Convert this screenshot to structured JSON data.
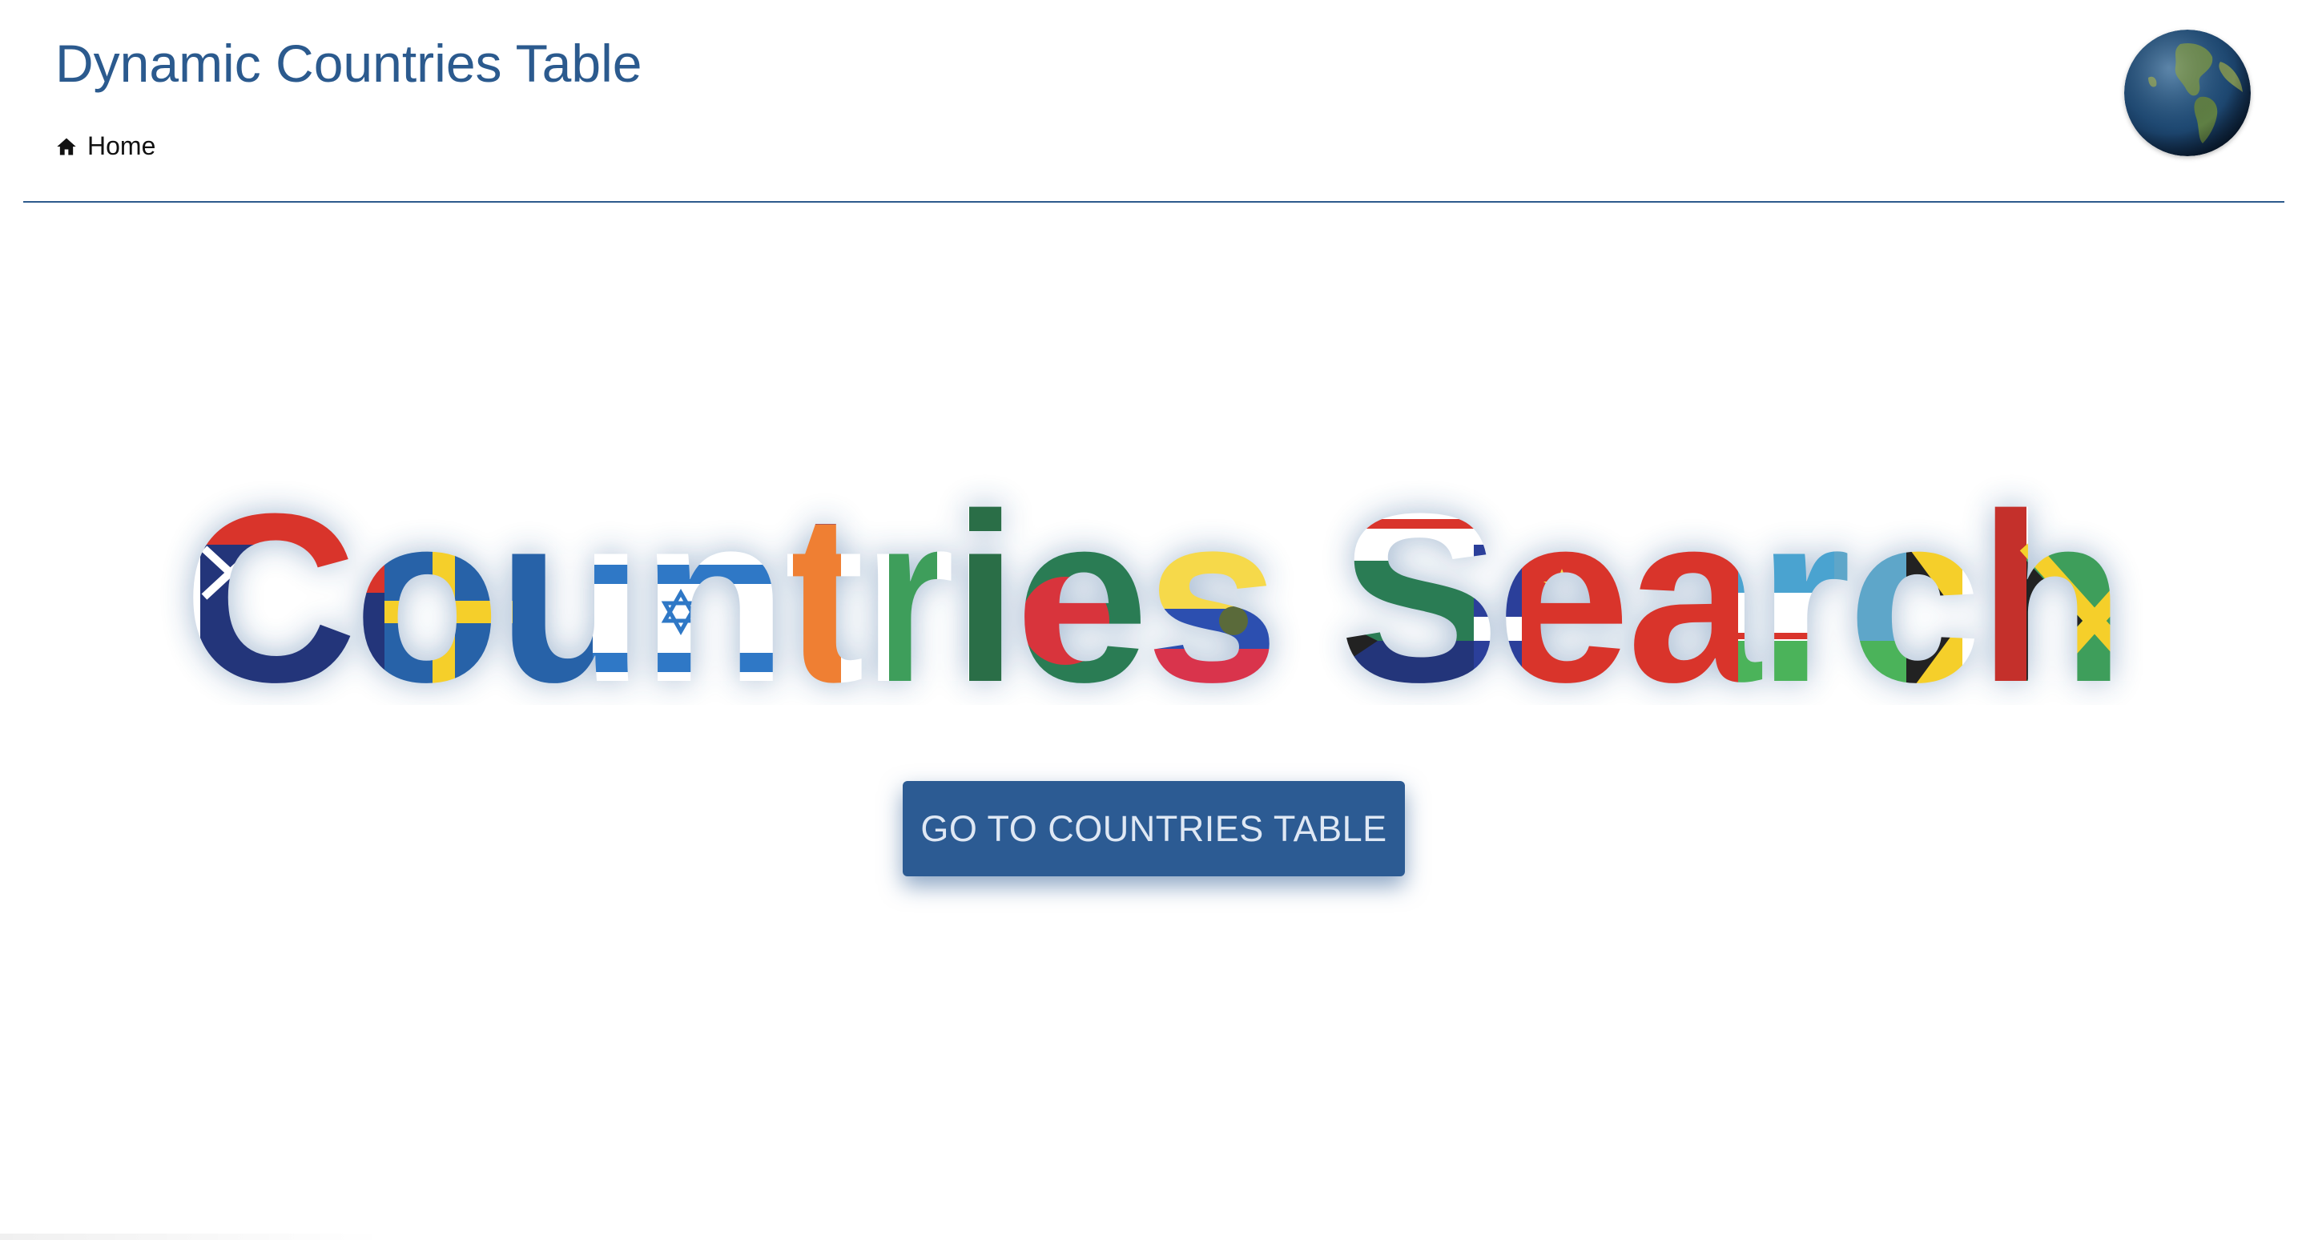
{
  "header": {
    "title": "Dynamic Countries Table",
    "nav": [
      {
        "label": "Home",
        "icon": "home-icon"
      }
    ],
    "logo_icon": "globe-icon"
  },
  "hero": {
    "title": "Countries Search",
    "title_fill": "country-flag-mosaic",
    "button_label": "GO TO COUNTRIES TABLE"
  },
  "colors": {
    "primary": "#2c5b93",
    "title_blue": "#2b5a8e",
    "divider": "#2d5a8c",
    "button_text": "#dfe8f4"
  }
}
